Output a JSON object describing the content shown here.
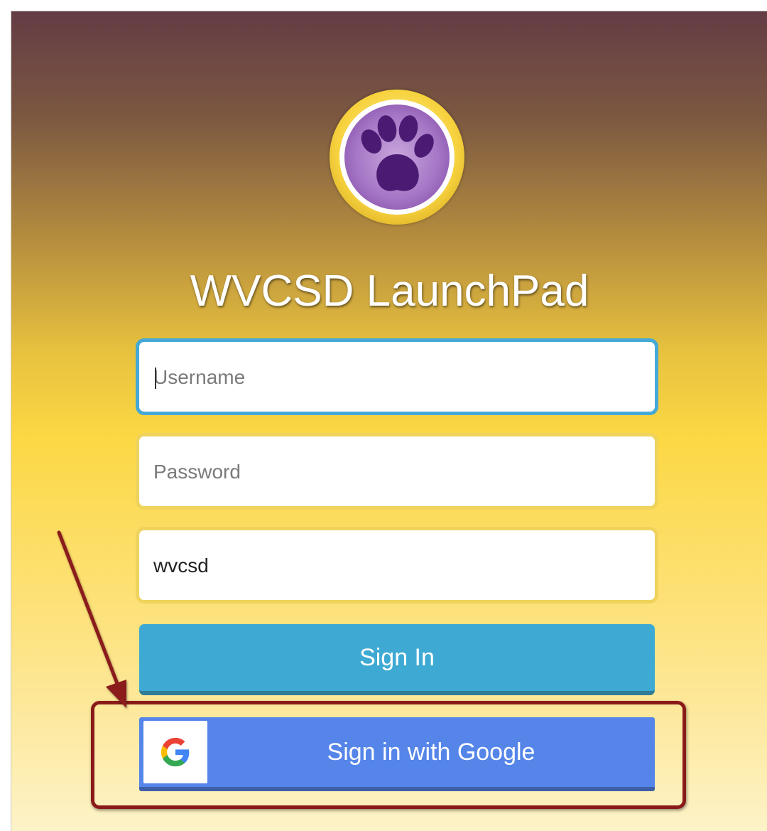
{
  "page": {
    "title": "WVCSD LaunchPad",
    "logo": "paw-print-logo"
  },
  "login_form": {
    "username_placeholder": "Username",
    "password_placeholder": "Password",
    "district_value": "wvcsd",
    "sign_in_label": "Sign In",
    "google_sign_in_label": "Sign in with Google"
  },
  "annotation": {
    "arrow": "red-arrow-icon",
    "highlight": "red-highlight-box"
  },
  "colors": {
    "background_top": "#643c45",
    "background_bottom": "#fdf3c9",
    "sign_in_button": "#3eaad3",
    "google_button": "#5585e8",
    "focused_border": "#44a9d6",
    "field_border": "#efd35c",
    "annotation": "#8a1a1a"
  }
}
